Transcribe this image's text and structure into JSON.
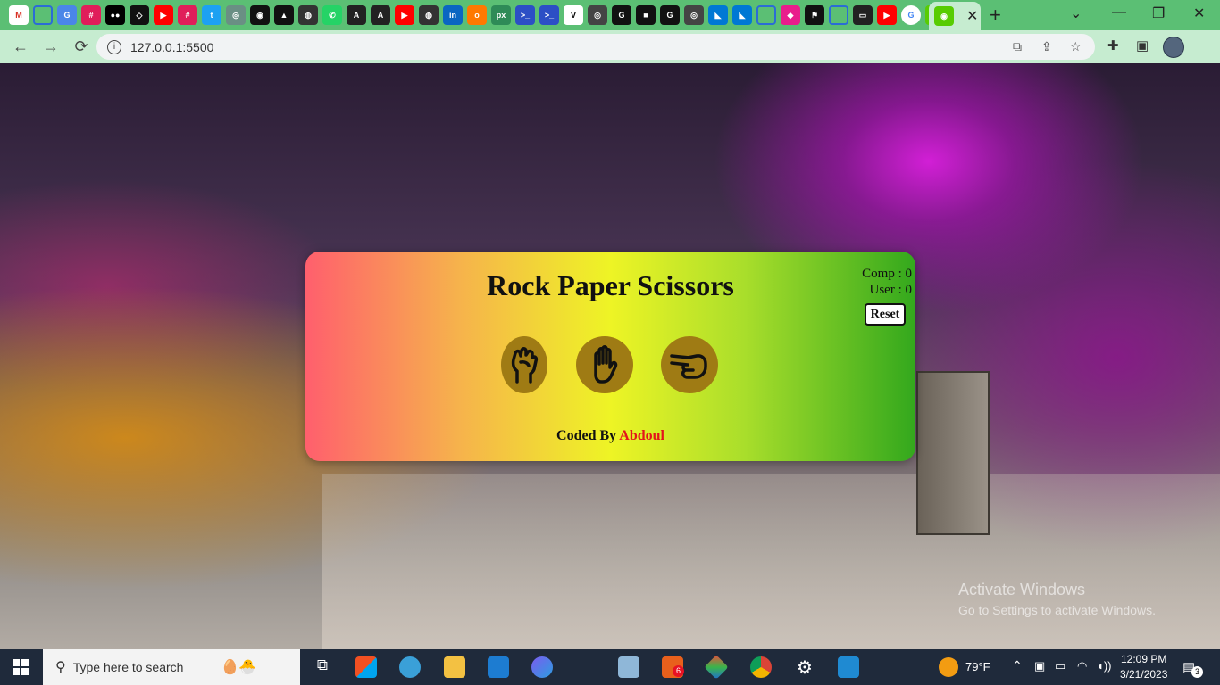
{
  "browser": {
    "url": "127.0.0.1:5500",
    "tab_close_symbol": "✕",
    "new_tab_symbol": "+"
  },
  "game": {
    "title": "Rock Paper Scissors",
    "comp_score_label": "Comp : 0",
    "user_score_label": "User : 0",
    "reset_label": "Reset",
    "choices": [
      "rock-icon",
      "paper-icon",
      "scissors-icon"
    ],
    "credit_prefix": "Coded By",
    "credit_name": "Abdoul",
    "colors": {
      "gradient_start": "#ff5f6d",
      "gradient_mid": "#eef425",
      "gradient_end": "#33a81d",
      "choice_bg": "#9f7b14",
      "credit_name": "#e3151b"
    }
  },
  "windows": {
    "activate_title": "Activate Windows",
    "activate_sub": "Go to Settings to activate Windows."
  },
  "taskbar": {
    "search_placeholder": "Type here to search",
    "weather": "79°F",
    "time": "12:09 PM",
    "date": "3/21/2023",
    "notifications": "3",
    "app_badge": "6"
  }
}
